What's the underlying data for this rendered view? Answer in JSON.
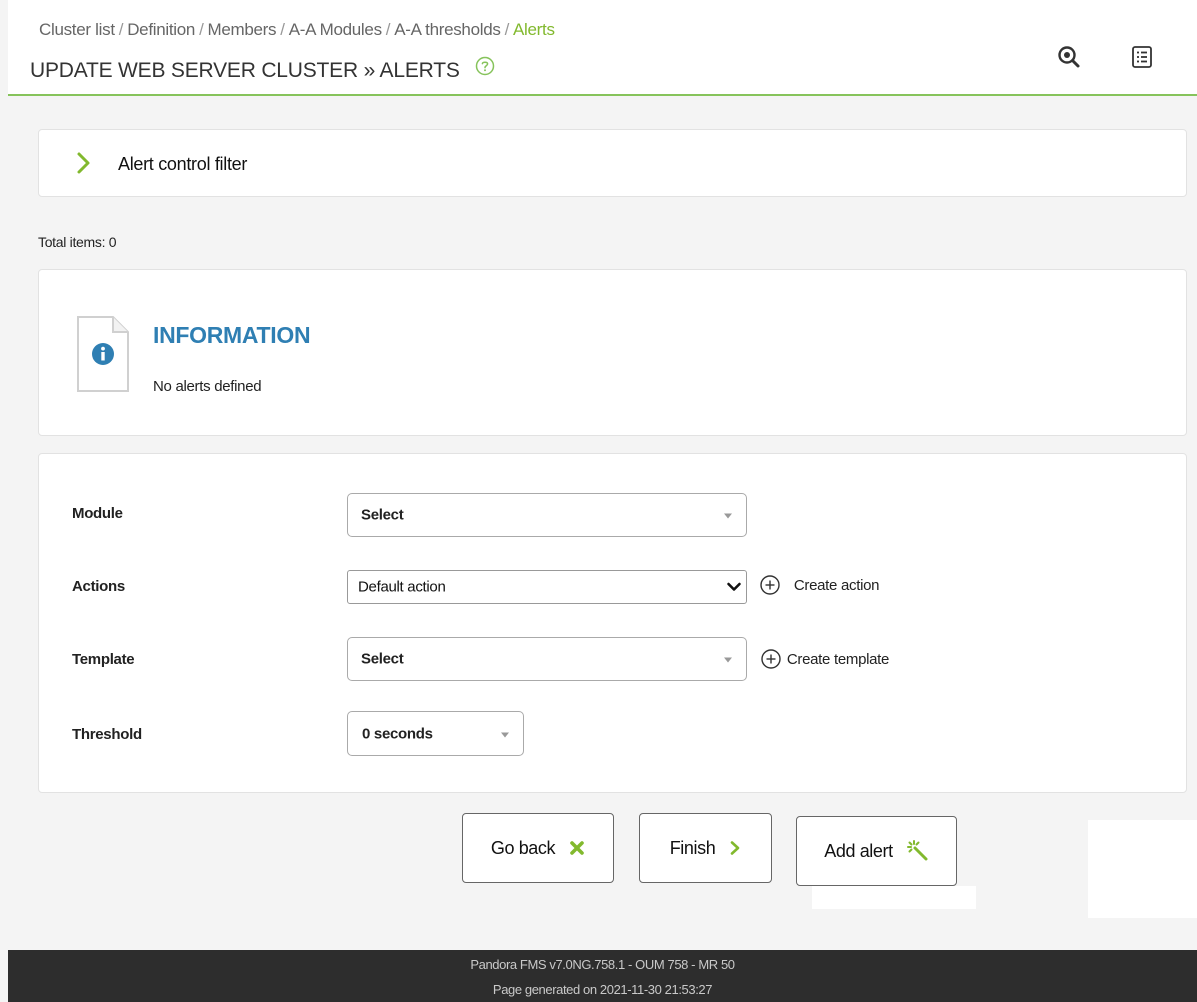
{
  "breadcrumb": {
    "items": [
      "Cluster list",
      "Definition",
      "Members",
      "A-A Modules",
      "A-A thresholds"
    ],
    "active": "Alerts",
    "separator": "/"
  },
  "page": {
    "title": "UPDATE WEB SERVER CLUSTER » ALERTS"
  },
  "filter": {
    "label": "Alert control filter"
  },
  "total_items": "Total items: 0",
  "info": {
    "title": "INFORMATION",
    "message": "No alerts defined"
  },
  "form": {
    "module": {
      "label": "Module",
      "value": "Select"
    },
    "actions": {
      "label": "Actions",
      "value": "Default action",
      "create_label": "Create action"
    },
    "template": {
      "label": "Template",
      "value": "Select",
      "create_label": "Create template"
    },
    "threshold": {
      "label": "Threshold",
      "value": "0 seconds"
    }
  },
  "buttons": {
    "go_back": "Go back",
    "finish": "Finish",
    "add_alert": "Add alert"
  },
  "footer": {
    "version": "Pandora FMS v7.0NG.758.1 - OUM 758 - MR 50",
    "generated": "Page generated on 2021-11-30 21:53:27"
  },
  "colors": {
    "accent": "#82b92e",
    "info_title": "#2f7fb3",
    "footer_bg": "#2d2d2d"
  },
  "icons": [
    "help-icon",
    "zoom-icon",
    "list-view-icon",
    "chevron-right-icon",
    "info-document-icon",
    "add-circle-icon",
    "close-icon",
    "wand-icon"
  ]
}
